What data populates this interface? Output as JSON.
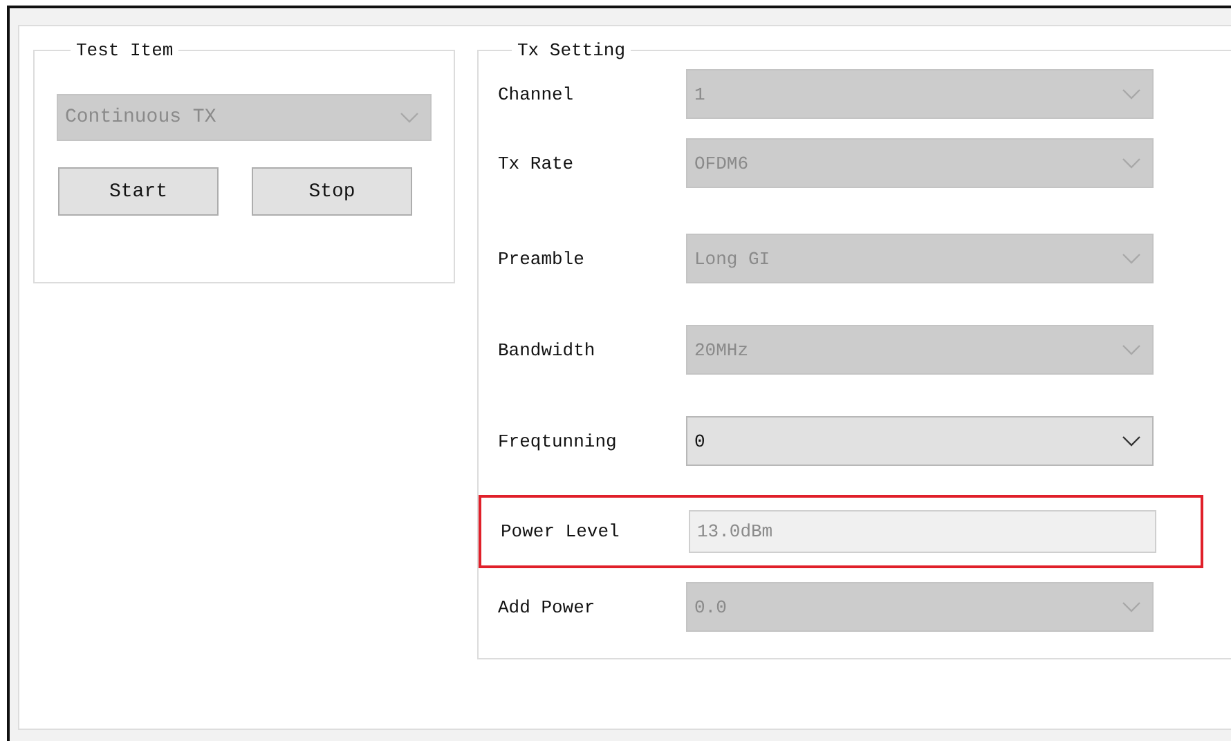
{
  "test_item": {
    "title": "Test Item",
    "mode": {
      "value": "Continuous TX",
      "disabled": true
    },
    "buttons": [
      "Start",
      "Stop"
    ]
  },
  "tx_setting": {
    "title": "Tx Setting",
    "rows": [
      {
        "label": "Channel",
        "kind": "select",
        "value": "1",
        "disabled": true,
        "highlighted": false
      },
      {
        "label": "Tx Rate",
        "kind": "select",
        "value": "OFDM6",
        "disabled": true,
        "highlighted": false
      },
      {
        "label": "Preamble",
        "kind": "select",
        "value": "Long GI",
        "disabled": true,
        "highlighted": false
      },
      {
        "label": "Bandwidth",
        "kind": "select",
        "value": "20MHz",
        "disabled": true,
        "highlighted": false
      },
      {
        "label": "Freqtunning",
        "kind": "select",
        "value": "0",
        "disabled": false,
        "highlighted": false
      },
      {
        "label": "Power Level",
        "kind": "text",
        "value": "13.0dBm",
        "disabled": true,
        "highlighted": true
      },
      {
        "label": "Add Power",
        "kind": "select",
        "value": "0.0",
        "disabled": true,
        "highlighted": false
      }
    ]
  }
}
